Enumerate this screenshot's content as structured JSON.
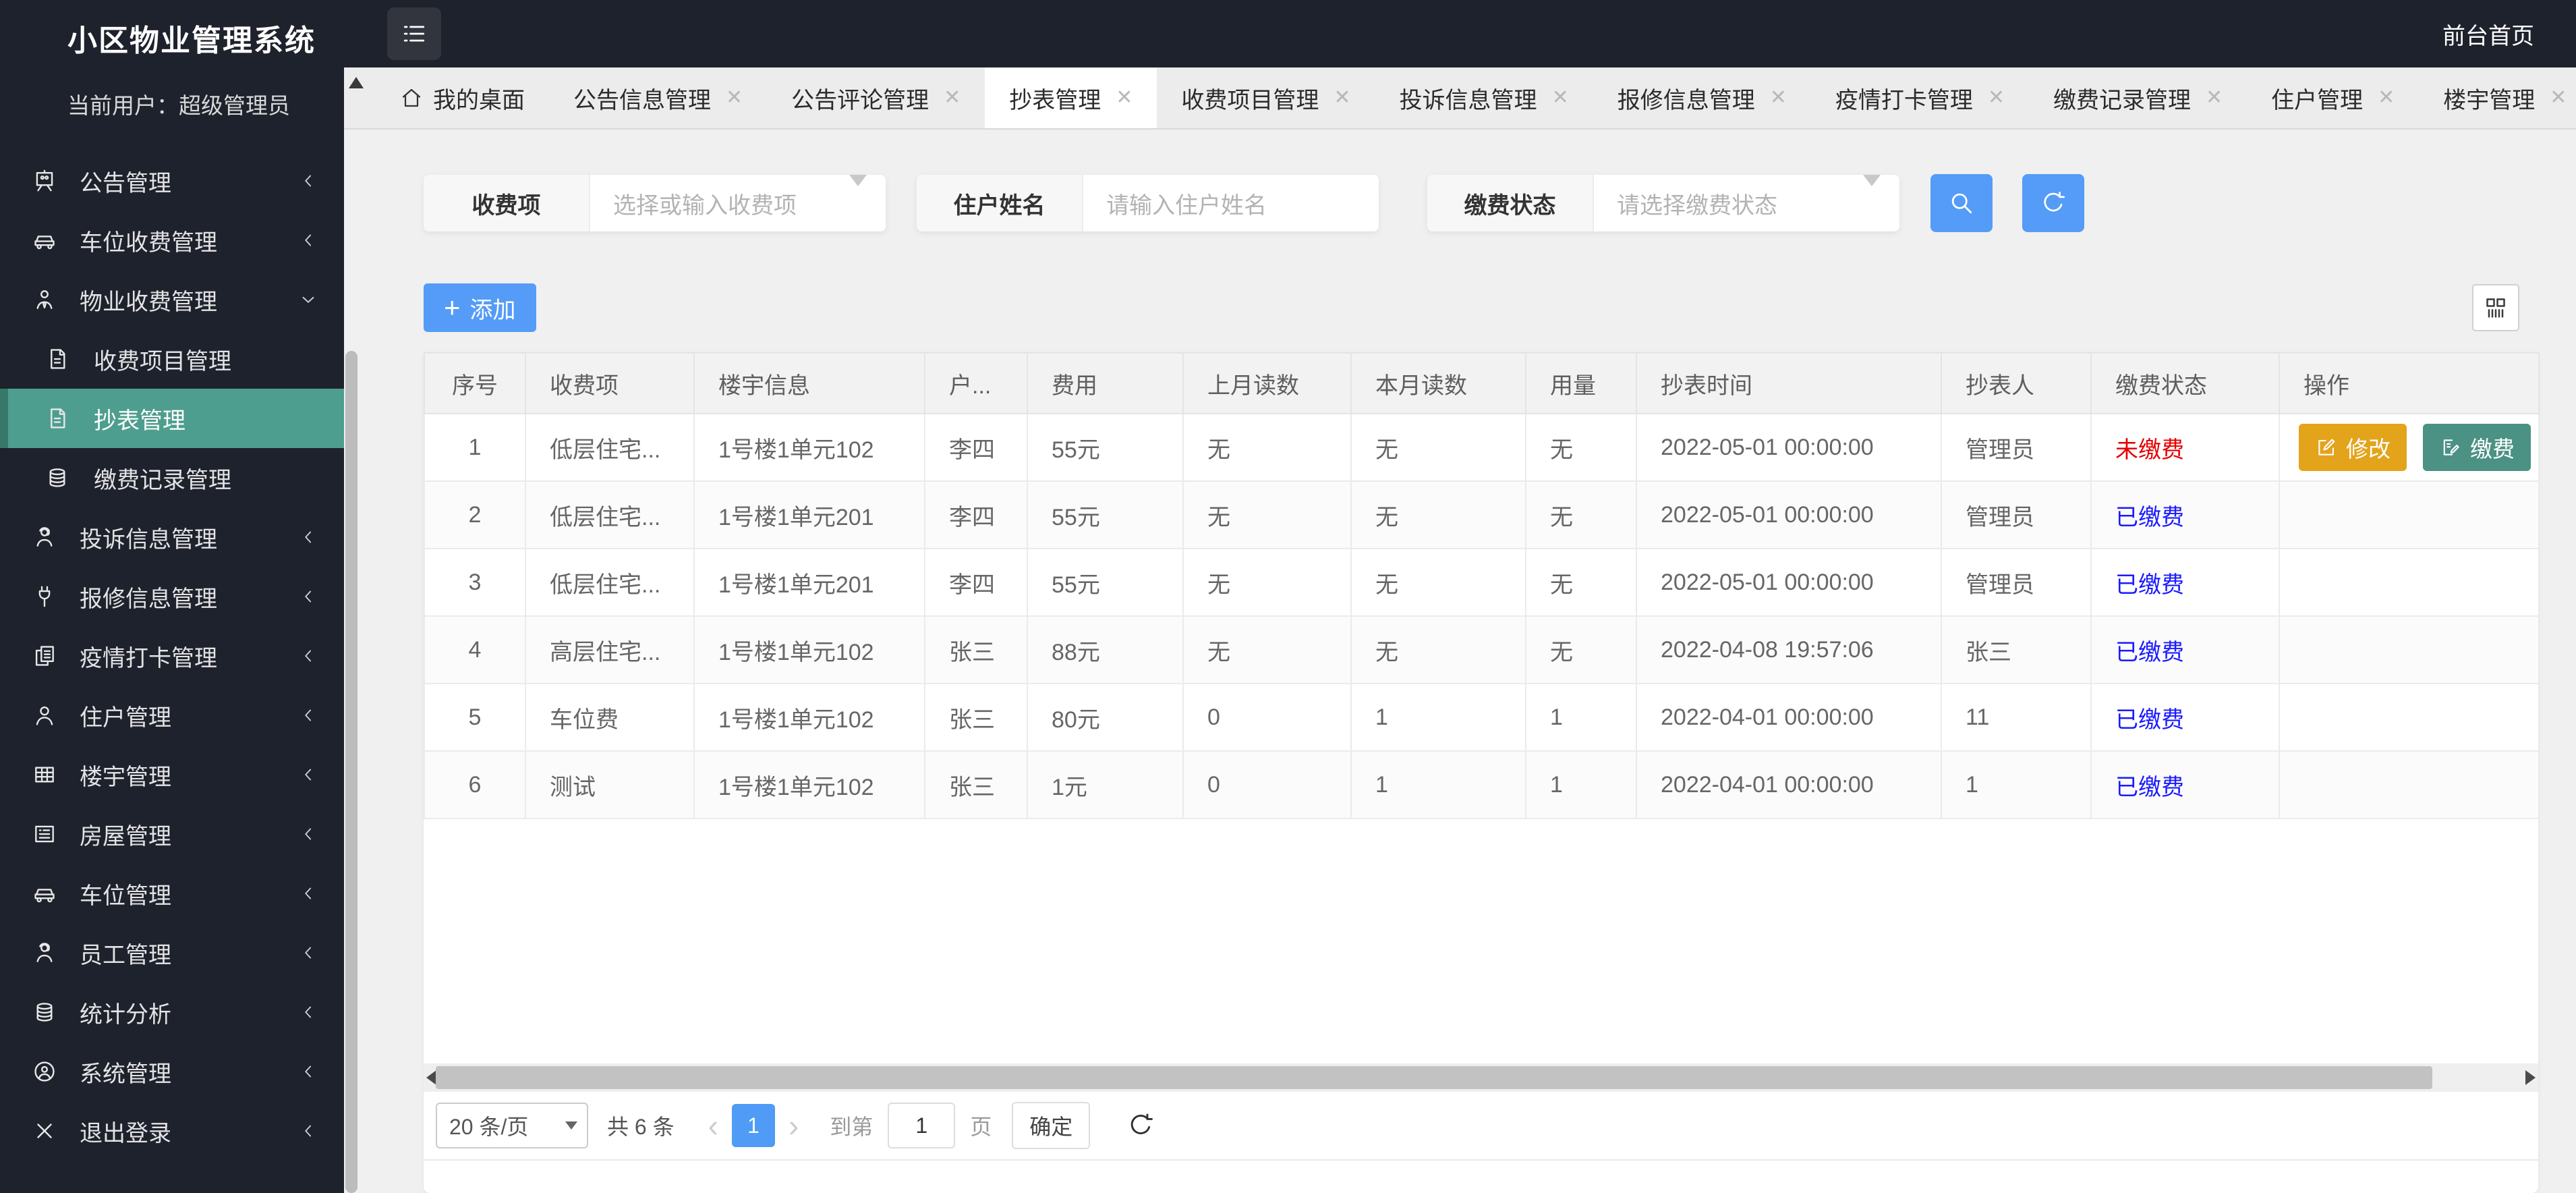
{
  "app": {
    "title": "小区物业管理系统",
    "current_user": "当前用户：超级管理员",
    "front_home_link": "前台首页",
    "hamburger_icon": "menu-list-icon"
  },
  "colors": {
    "sidebar_dark": "#1e222c",
    "active_menu_teal": "#4e9e8f",
    "accent_blue": "#549cf7",
    "edit_amber": "#e3a41c",
    "pay_teal": "#4b9184",
    "status_unpaid_red": "#e60000",
    "status_paid_blue": "#1b1bff"
  },
  "tabs": [
    {
      "label": "我的桌面",
      "icon": "home-icon",
      "closable": false,
      "active": false
    },
    {
      "label": "公告信息管理",
      "closable": true,
      "active": false
    },
    {
      "label": "公告评论管理",
      "closable": true,
      "active": false
    },
    {
      "label": "抄表管理",
      "closable": true,
      "active": true
    },
    {
      "label": "收费项目管理",
      "closable": true,
      "active": false
    },
    {
      "label": "投诉信息管理",
      "closable": true,
      "active": false
    },
    {
      "label": "报修信息管理",
      "closable": true,
      "active": false
    },
    {
      "label": "疫情打卡管理",
      "closable": true,
      "active": false
    },
    {
      "label": "缴费记录管理",
      "closable": true,
      "active": false
    },
    {
      "label": "住户管理",
      "closable": true,
      "active": false
    },
    {
      "label": "楼宇管理",
      "closable": true,
      "active": false
    }
  ],
  "sidebar": {
    "items": [
      {
        "label": "公告管理",
        "icon": "board-icon",
        "chevron": "left"
      },
      {
        "label": "车位收费管理",
        "icon": "car-icon",
        "chevron": "left"
      },
      {
        "label": "物业收费管理",
        "icon": "person-tie-icon",
        "chevron": "down",
        "expanded": true,
        "children": [
          {
            "label": "收费项目管理",
            "icon": "document-icon"
          },
          {
            "label": "抄表管理",
            "icon": "document-icon",
            "active": true
          },
          {
            "label": "缴费记录管理",
            "icon": "database-icon"
          }
        ]
      },
      {
        "label": "投诉信息管理",
        "icon": "headset-person-icon",
        "chevron": "left"
      },
      {
        "label": "报修信息管理",
        "icon": "plug-icon",
        "chevron": "left"
      },
      {
        "label": "疫情打卡管理",
        "icon": "copy-icon",
        "chevron": "left"
      },
      {
        "label": "住户管理",
        "icon": "user-icon",
        "chevron": "left"
      },
      {
        "label": "楼宇管理",
        "icon": "table-grid-icon",
        "chevron": "left"
      },
      {
        "label": "房屋管理",
        "icon": "card-list-icon",
        "chevron": "left"
      },
      {
        "label": "车位管理",
        "icon": "car-icon",
        "chevron": "left"
      },
      {
        "label": "员工管理",
        "icon": "headset-person-icon",
        "chevron": "left"
      },
      {
        "label": "统计分析",
        "icon": "database-icon",
        "chevron": "left"
      },
      {
        "label": "系统管理",
        "icon": "user-circle-icon",
        "chevron": "left"
      },
      {
        "label": "退出登录",
        "icon": "logout-x-icon",
        "chevron": "left"
      }
    ]
  },
  "filters": {
    "fee_item": {
      "label": "收费项",
      "placeholder": "选择或输入收费项",
      "type": "select"
    },
    "resident_name": {
      "label": "住户姓名",
      "placeholder": "请输入住户姓名",
      "type": "input"
    },
    "pay_status": {
      "label": "缴费状态",
      "placeholder": "请选择缴费状态",
      "type": "select"
    },
    "search_icon": "search-icon",
    "refresh_icon": "refresh-icon"
  },
  "toolbar": {
    "add_label": "添加",
    "columns_icon": "columns-grid-icon"
  },
  "table": {
    "columns": [
      "序号",
      "收费项",
      "楼宇信息",
      "户...",
      "费用",
      "上月读数",
      "本月读数",
      "用量",
      "抄表时间",
      "抄表人",
      "缴费状态",
      "操作"
    ],
    "rows": [
      {
        "cells": [
          "1",
          "低层住宅...",
          "1号楼1单元102",
          "李四",
          "55元",
          "无",
          "无",
          "无",
          "2022-05-01 00:00:00",
          "管理员"
        ],
        "status": "未缴费",
        "status_color": "red",
        "actions": [
          {
            "label": "修改",
            "icon": "edit-icon",
            "style": "edit"
          },
          {
            "label": "缴费",
            "icon": "pay-icon",
            "style": "pay"
          }
        ]
      },
      {
        "cells": [
          "2",
          "低层住宅...",
          "1号楼1单元201",
          "李四",
          "55元",
          "无",
          "无",
          "无",
          "2022-05-01 00:00:00",
          "管理员"
        ],
        "status": "已缴费",
        "status_color": "blue",
        "actions": []
      },
      {
        "cells": [
          "3",
          "低层住宅...",
          "1号楼1单元201",
          "李四",
          "55元",
          "无",
          "无",
          "无",
          "2022-05-01 00:00:00",
          "管理员"
        ],
        "status": "已缴费",
        "status_color": "blue",
        "actions": []
      },
      {
        "cells": [
          "4",
          "高层住宅...",
          "1号楼1单元102",
          "张三",
          "88元",
          "无",
          "无",
          "无",
          "2022-04-08 19:57:06",
          "张三"
        ],
        "status": "已缴费",
        "status_color": "blue",
        "actions": []
      },
      {
        "cells": [
          "5",
          "车位费",
          "1号楼1单元102",
          "张三",
          "80元",
          "0",
          "1",
          "1",
          "2022-04-01 00:00:00",
          "11"
        ],
        "status": "已缴费",
        "status_color": "blue",
        "actions": []
      },
      {
        "cells": [
          "6",
          "测试",
          "1号楼1单元102",
          "张三",
          "1元",
          "0",
          "1",
          "1",
          "2022-04-01 00:00:00",
          "1"
        ],
        "status": "已缴费",
        "status_color": "blue",
        "actions": []
      }
    ]
  },
  "pagination": {
    "page_size": "20 条/页",
    "total": "共 6 条",
    "prev": "‹",
    "current_page": "1",
    "next": "›",
    "goto_prefix": "到第",
    "goto_value": "1",
    "goto_suffix": "页",
    "confirm": "确定",
    "refresh_icon": "refresh-icon"
  }
}
